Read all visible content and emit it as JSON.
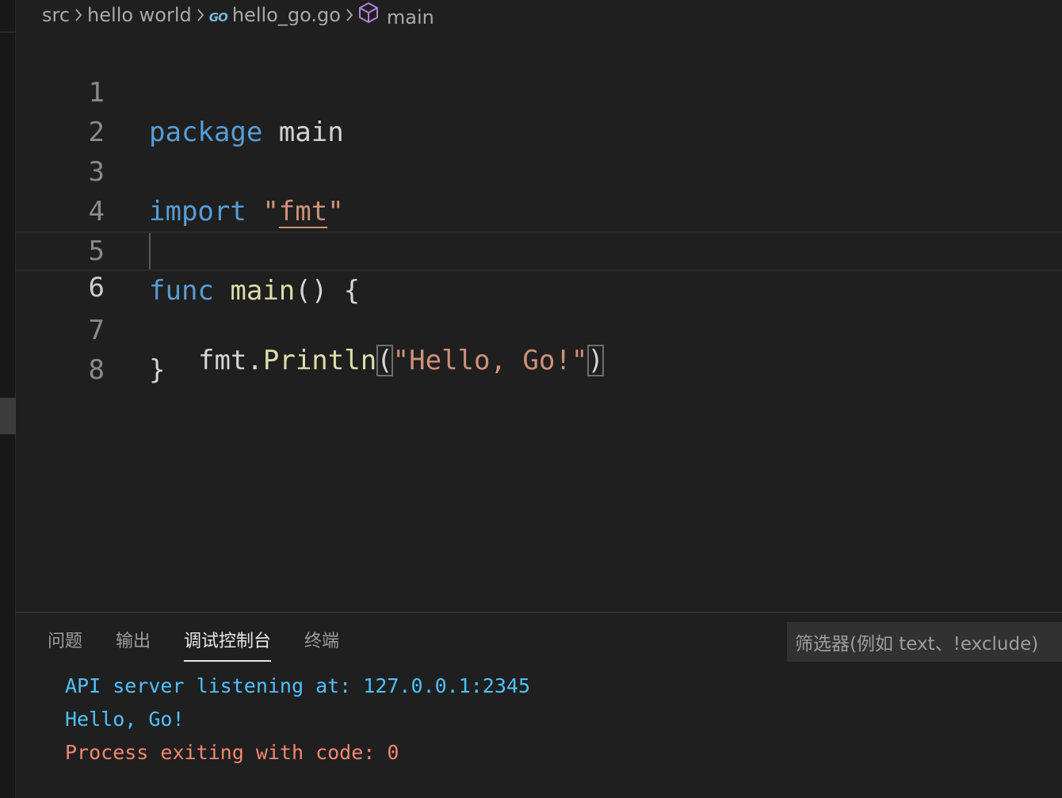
{
  "breadcrumb": {
    "items": [
      "src",
      "hello world",
      "hello_go.go",
      "main"
    ],
    "go_badge": "GO"
  },
  "editor": {
    "line_numbers": [
      "1",
      "2",
      "3",
      "4",
      "5",
      "6",
      "7",
      "8"
    ],
    "current_line": "6",
    "lines": {
      "l1": {
        "kw": "package",
        "id": "main"
      },
      "l3": {
        "kw": "import",
        "q1": "\"",
        "pkg": "fmt",
        "q2": "\""
      },
      "l5": {
        "kw": "func",
        "fn": "main",
        "rest": "() {"
      },
      "l6": {
        "obj": "fmt.",
        "fn": "Println",
        "open": "(",
        "str": "\"Hello, Go!\"",
        "close": ")"
      },
      "l7": {
        "brace": "}"
      }
    }
  },
  "panel": {
    "tabs": [
      "问题",
      "输出",
      "调试控制台",
      "终端"
    ],
    "active_tab": "调试控制台",
    "filter_placeholder": "筛选器(例如 text、!exclude)",
    "console": [
      {
        "text": "API server listening at: 127.0.0.1:2345",
        "kind": "out"
      },
      {
        "text": "Hello, Go!",
        "kind": "out"
      },
      {
        "text": "Process exiting with code: 0",
        "kind": "err"
      }
    ]
  },
  "colors": {
    "background": "#1f1f1f",
    "keyword": "#569cd6",
    "function": "#dcdcaa",
    "string": "#ce9178",
    "console_out": "#4fc1ff",
    "console_err": "#f48771"
  }
}
